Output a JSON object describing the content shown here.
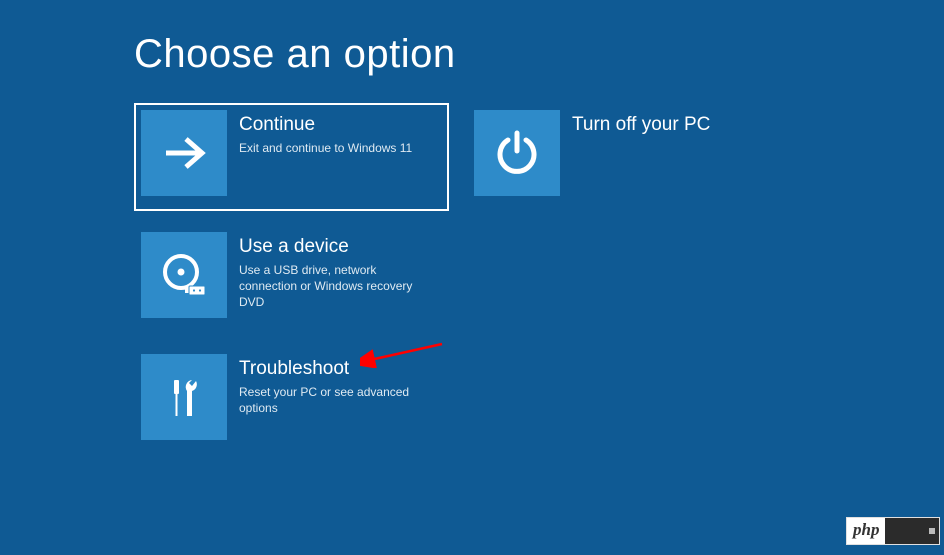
{
  "title": "Choose an option",
  "options": {
    "continue": {
      "title": "Continue",
      "desc": "Exit and continue to Windows 11"
    },
    "poweroff": {
      "title": "Turn off your PC",
      "desc": ""
    },
    "device": {
      "title": "Use a device",
      "desc": "Use a USB drive, network connection or Windows recovery DVD"
    },
    "troubleshoot": {
      "title": "Troubleshoot",
      "desc": "Reset your PC or see advanced options"
    }
  },
  "watermark": {
    "text": "php"
  },
  "colors": {
    "background": "#0f5a94",
    "tile": "#2e8bc9",
    "annotation": "#ff0000"
  }
}
